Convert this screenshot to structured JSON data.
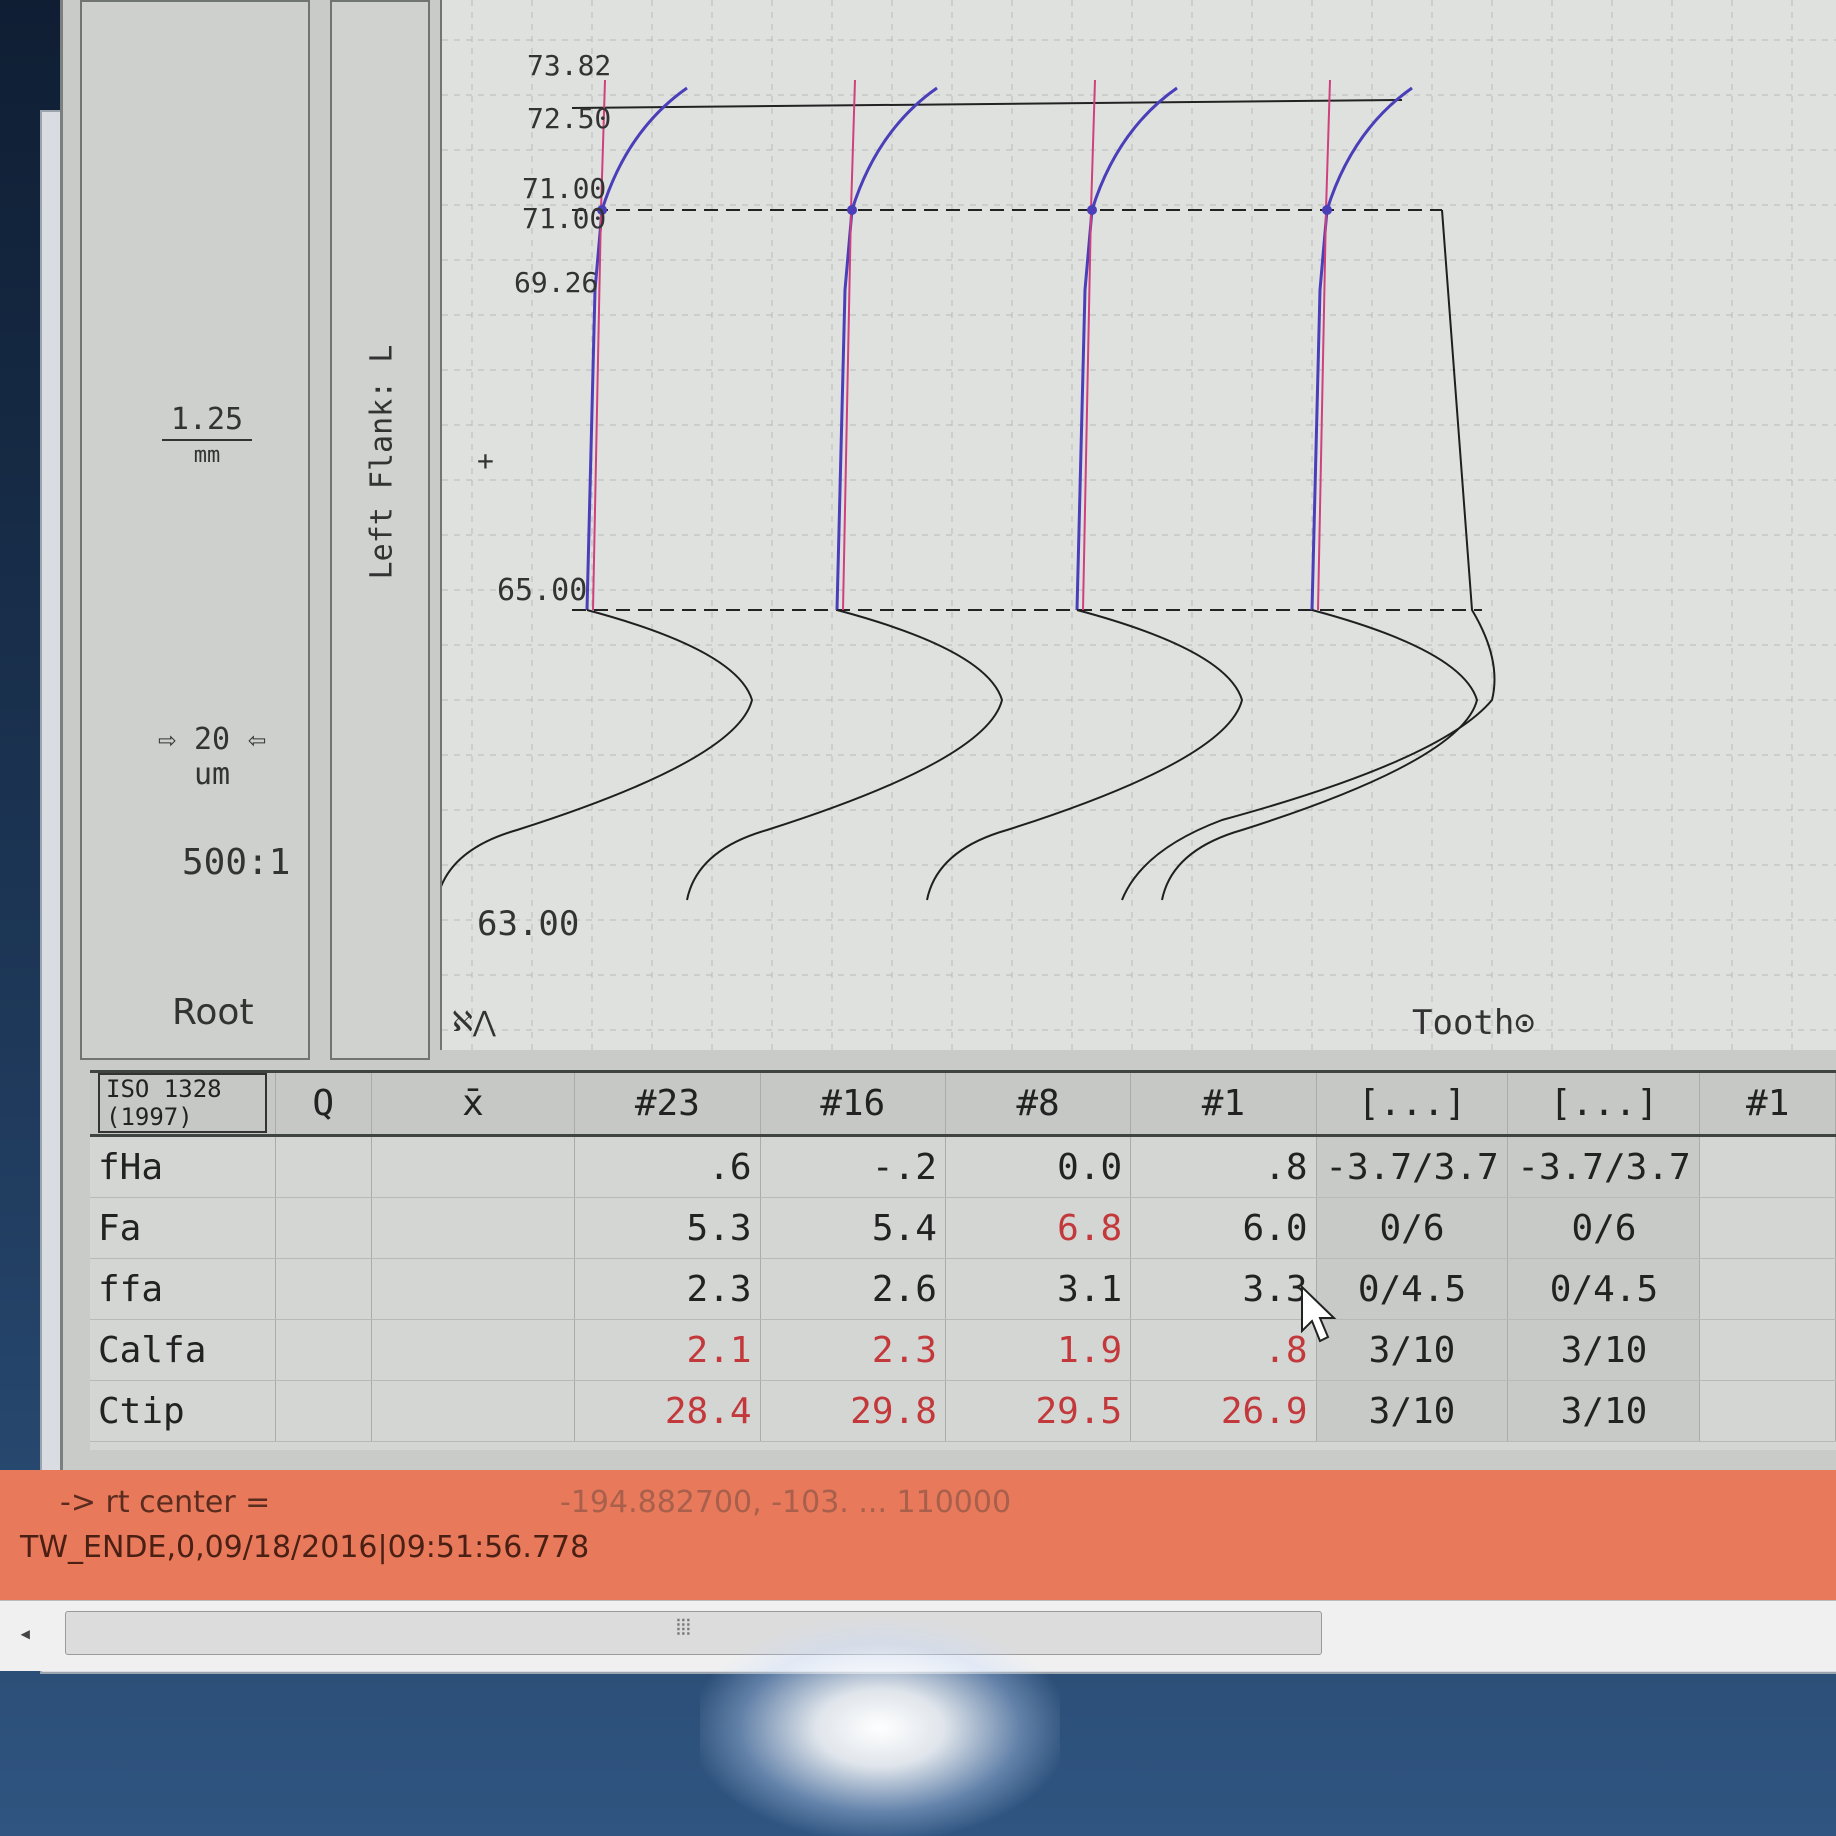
{
  "axis": {
    "labels": [
      "73.82",
      "72.50",
      "71.00",
      "71.00",
      "69.26",
      "65.00",
      "63.00"
    ]
  },
  "left_panel": {
    "scale_value": "1.25",
    "scale_unit": "mm",
    "width_value": "20",
    "width_unit": "um",
    "ratio": "500:1",
    "root_label": "Root"
  },
  "flank_label": "Left Flank: L",
  "tooth_label": "Tooth",
  "table": {
    "standard": "ISO 1328 (1997)",
    "q_header": "Q",
    "mean_header": "x̄",
    "columns": [
      "#23",
      "#16",
      "#8",
      "#1",
      "[...]",
      "[...]",
      "#1"
    ],
    "rows": [
      {
        "name": "fHa",
        "values": [
          ".6",
          "-.2",
          "0.0",
          ".8"
        ],
        "red": [
          false,
          false,
          false,
          false
        ],
        "tol": [
          "-3.7/3.7",
          "-3.7/3.7"
        ]
      },
      {
        "name": "Fa",
        "values": [
          "5.3",
          "5.4",
          "6.8",
          "6.0"
        ],
        "red": [
          false,
          false,
          true,
          false
        ],
        "tol": [
          "0/6",
          "0/6"
        ]
      },
      {
        "name": "ffa",
        "values": [
          "2.3",
          "2.6",
          "3.1",
          "3.3"
        ],
        "red": [
          false,
          false,
          false,
          false
        ],
        "tol": [
          "0/4.5",
          "0/4.5"
        ]
      },
      {
        "name": "Calfa",
        "values": [
          "2.1",
          "2.3",
          "1.9",
          ".8"
        ],
        "red": [
          true,
          true,
          true,
          true
        ],
        "tol": [
          "3/10",
          "3/10"
        ]
      },
      {
        "name": "Ctip",
        "values": [
          "28.4",
          "29.8",
          "29.5",
          "26.9"
        ],
        "red": [
          true,
          true,
          true,
          true
        ],
        "tol": [
          "3/10",
          "3/10"
        ]
      }
    ]
  },
  "status": {
    "line1": "-> rt center =",
    "line1_value": "-194.882700, -103. ... 110000",
    "line2": "TW_ENDE,0,09/18/2016|09:51:56.778"
  },
  "colors": {
    "trace_blue": "#4a3fb8",
    "trace_pink": "#d0407c",
    "trace_black": "#1f1f1f",
    "red_value": "#c3393b",
    "status_bar": "#e8795b"
  }
}
